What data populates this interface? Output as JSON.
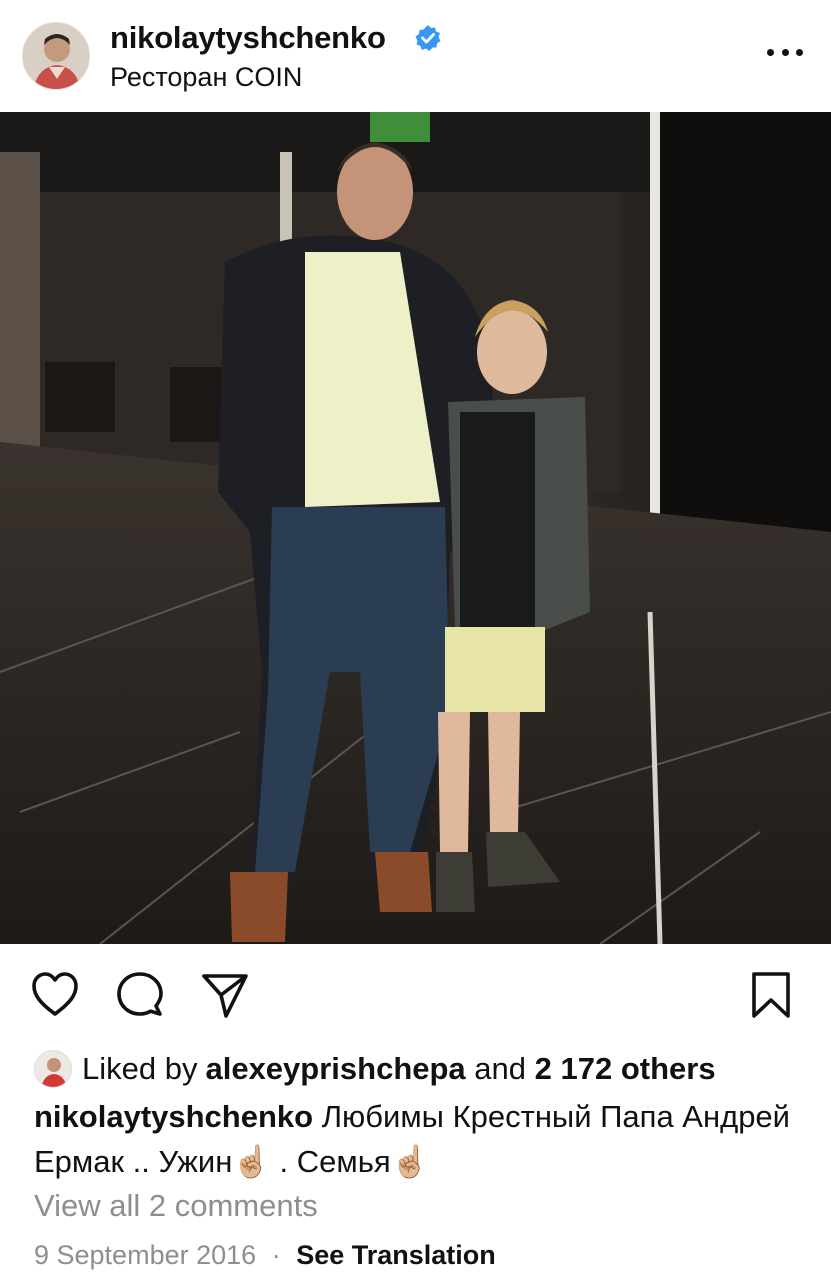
{
  "post": {
    "username": "nikolaytyshchenko",
    "location": "Ресторан COIN",
    "verified": true
  },
  "icons": {
    "more": "more-horizontal-icon",
    "like": "heart-icon",
    "comment": "comment-icon",
    "share": "send-icon",
    "save": "bookmark-icon"
  },
  "likes": {
    "prefix": "Liked by ",
    "user": "alexeyprishchepa",
    "mid": " and ",
    "count": "2 172 others"
  },
  "caption": {
    "author": "nikolaytyshchenko",
    "text": " Любимы Крестный Папа Андрей Ермак .. Ужин☝🏼 . Семья☝🏼"
  },
  "comments": {
    "link": "View all 2 comments"
  },
  "footer": {
    "date": "9 September 2016",
    "separator": "·",
    "translate": "See Translation"
  },
  "colors": {
    "verified_blue": "#3897f0",
    "muted": "#8e8e8e",
    "text": "#111111"
  }
}
